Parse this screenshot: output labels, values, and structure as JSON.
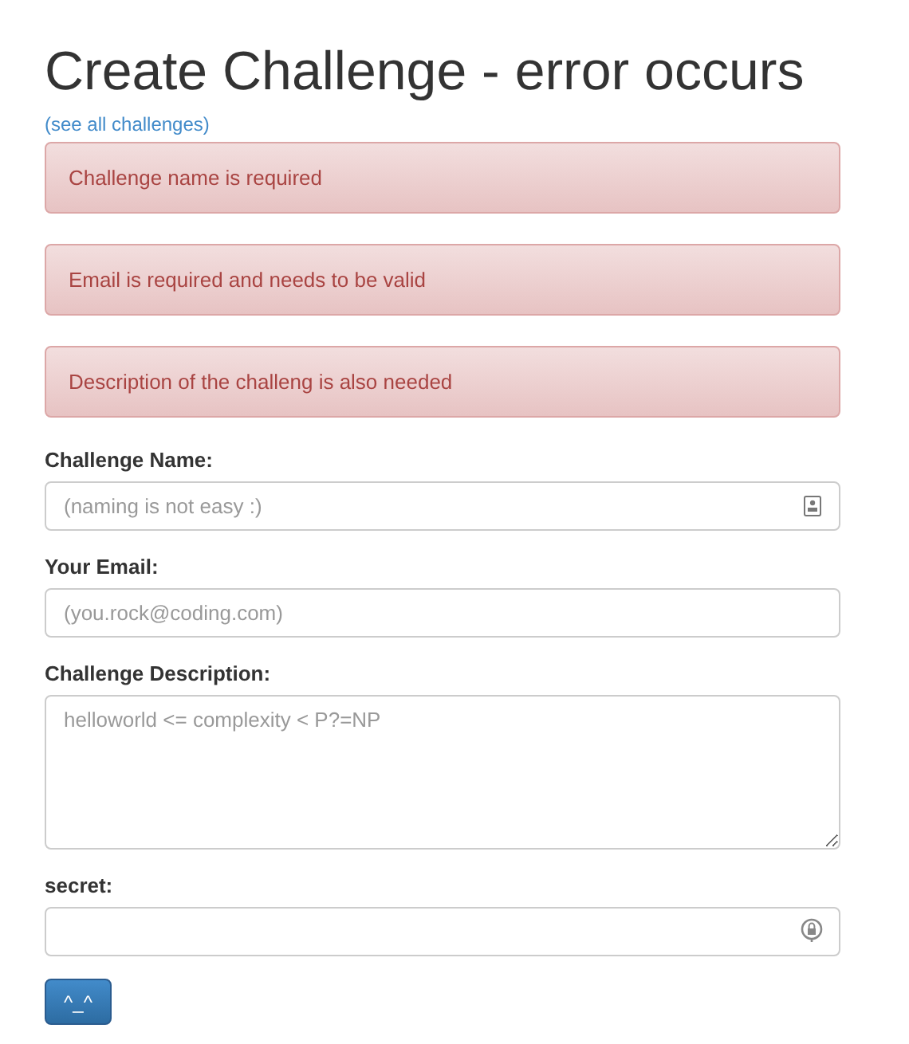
{
  "title": "Create Challenge - error occurs",
  "link": "(see all challenges)",
  "errors": [
    "Challenge name is required",
    "Email is required and needs to be valid",
    "Description of the challeng is also needed"
  ],
  "fields": [
    {
      "label": "Challenge Name:",
      "kind": "text",
      "placeholder": "(naming is not easy :)"
    },
    {
      "label": "Your Email:",
      "kind": "email",
      "placeholder": "(you.rock@coding.com)"
    },
    {
      "label": "Challenge Description:",
      "kind": "textarea",
      "placeholder": "helloworld <= complexity < P?=NP"
    },
    {
      "label": "secret:",
      "kind": "password"
    }
  ],
  "submit": "^_^"
}
